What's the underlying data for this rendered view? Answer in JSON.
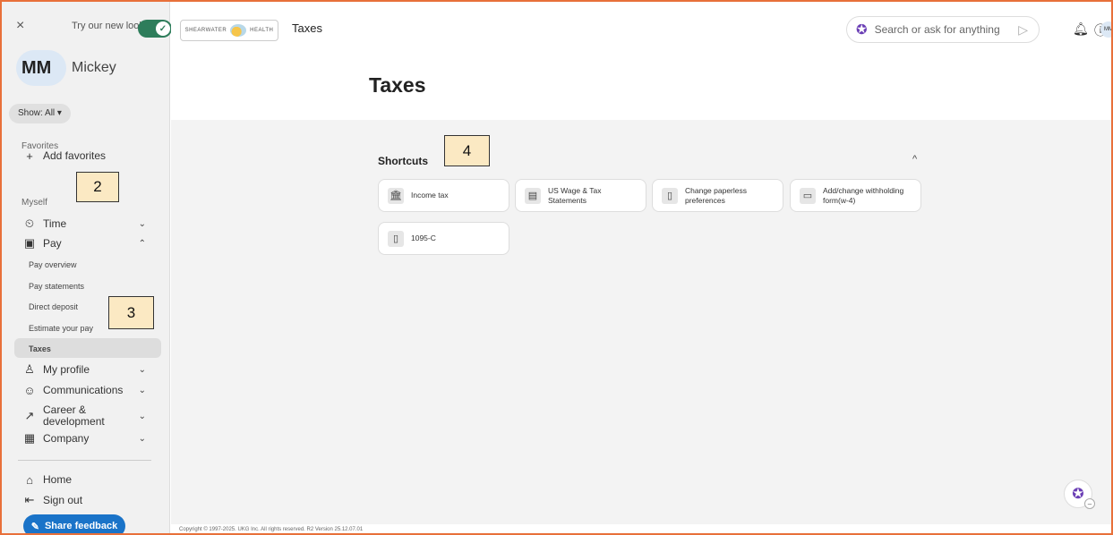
{
  "sidebar": {
    "close_icon": "×",
    "try_new_look": "Try our new look",
    "toggle_on": "✓",
    "avatar_initials": "MM",
    "user_name": "Mickey",
    "show_all": "Show: All ▾",
    "favorites_label": "Favorites",
    "add_favorites": "Add favorites",
    "myself_label": "Myself",
    "items": [
      {
        "label": "Time",
        "icon": "⏲",
        "chev": "⌄"
      },
      {
        "label": "Pay",
        "icon": "▣",
        "chev": "⌃"
      },
      {
        "label": "My profile",
        "icon": "♙",
        "chev": "⌄"
      },
      {
        "label": "Communications",
        "icon": "☺",
        "chev": "⌄"
      },
      {
        "label": "Career & development",
        "icon": "↗",
        "chev": "⌄"
      },
      {
        "label": "Company",
        "icon": "▦",
        "chev": "⌄"
      }
    ],
    "pay_sub": [
      "Pay overview",
      "Pay statements",
      "Direct deposit",
      "Estimate your pay",
      "Taxes"
    ],
    "home": "Home",
    "sign_out": "Sign out",
    "share_feedback": "Share feedback"
  },
  "callouts": [
    "2",
    "3",
    "4"
  ],
  "header": {
    "logo_left": "SHEARWATER",
    "logo_right": "HEALTH",
    "title": "Taxes",
    "search_placeholder": "Search or ask for anything",
    "avatar": "MM"
  },
  "main": {
    "page_title": "Taxes",
    "shortcuts_title": "Shortcuts",
    "collapse_icon": "^",
    "shortcuts": [
      {
        "label": "Income tax",
        "icon": "🏛"
      },
      {
        "label": "US Wage & Tax Statements",
        "icon": "▤"
      },
      {
        "label": "Change paperless preferences",
        "icon": "▯"
      },
      {
        "label": "Add/change withholding form(w-4)",
        "icon": "▭"
      },
      {
        "label": "1095-C",
        "icon": "▯"
      }
    ]
  },
  "footer": {
    "text": "Copyright © 1997-2025. UKG Inc. All rights reserved. R2 Version 25.12.07.01"
  },
  "colors": {
    "accent": "#2e7d5b",
    "feedback": "#1a73c8",
    "frame": "#e8703a"
  }
}
